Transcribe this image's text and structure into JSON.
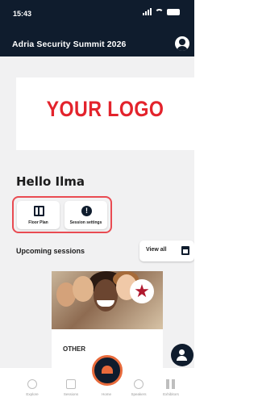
{
  "status": {
    "time": "15:43"
  },
  "header": {
    "title": "Adria Security Summit 2026",
    "account_icon": "account-circle-icon"
  },
  "logo": {
    "text": "YOUR LOGO",
    "color": "#e3232c"
  },
  "greeting": {
    "text": "Hello Ilma"
  },
  "quick_actions": [
    {
      "label": "Floor Plan",
      "icon": "map-icon"
    },
    {
      "label": "Session settings",
      "icon": "info-icon"
    }
  ],
  "upcoming": {
    "title": "Upcoming sessions",
    "view_all_label": "View all",
    "view_all_icon": "calendar-icon"
  },
  "session_card": {
    "category": "OTHER",
    "badge_icon": "star-icon"
  },
  "fab": {
    "icon": "add-person-icon"
  },
  "bottom_nav": {
    "items": [
      {
        "label": "Explore",
        "icon": "explore-icon"
      },
      {
        "label": "Sessions",
        "icon": "sessions-icon"
      },
      {
        "label": "Home",
        "icon": "home-icon"
      },
      {
        "label": "Speakers",
        "icon": "speakers-icon"
      },
      {
        "label": "Exhibitors",
        "icon": "exhibitors-icon"
      }
    ]
  },
  "colors": {
    "primary": "#0f1c2d",
    "accent": "#e94b52",
    "center": "#e86a3b",
    "background": "#f1f1f2"
  }
}
